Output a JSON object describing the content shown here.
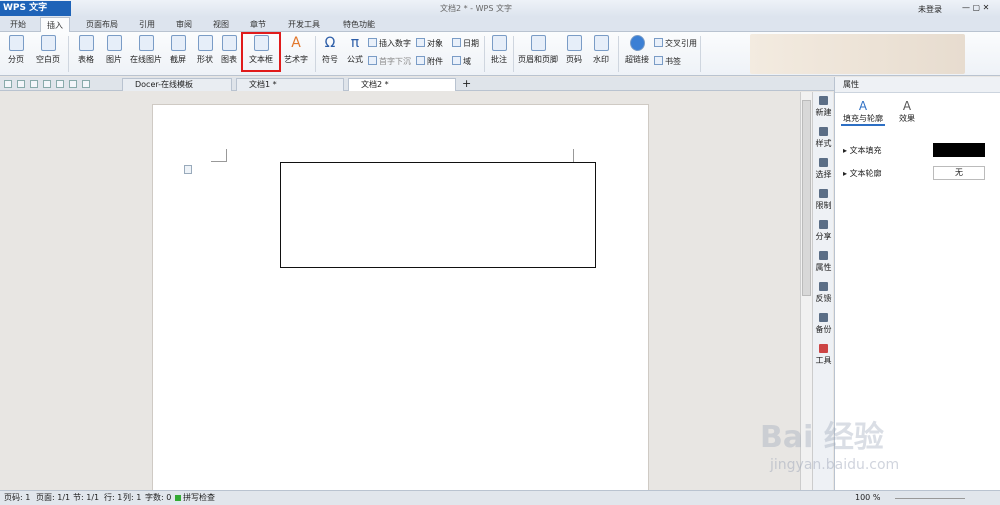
{
  "app": {
    "menu": "WPS 文字",
    "title": "文档2 * - WPS 文字",
    "user": "未登录"
  },
  "tabs": [
    "开始",
    "插入",
    "页面布局",
    "引用",
    "审阅",
    "视图",
    "章节",
    "开发工具",
    "特色功能"
  ],
  "ribbon": {
    "page_break": "分页",
    "blank_page": "空白页",
    "table": "表格",
    "picture": "图片",
    "online_picture": "在线图片",
    "screenshot": "截屏",
    "shape": "形状",
    "chart": "图表",
    "text_box": "文本框",
    "art_text": "艺术字",
    "symbol": "符号",
    "formula": "公式",
    "insert_number": "插入数字",
    "object": "对象",
    "date": "日期",
    "first_drop": "首字下沉",
    "attachment": "附件",
    "field": "域",
    "comment": "批注",
    "header_footer": "页眉和页脚",
    "page_number": "页码",
    "watermark": "水印",
    "hyperlink": "超链接",
    "cross_ref": "交叉引用",
    "bookmark": "书签"
  },
  "doc_tabs": [
    "Docer-在线模板",
    "文档1 *",
    "文档2 *"
  ],
  "sidebar": [
    "新建",
    "样式",
    "选择",
    "限制",
    "分享",
    "属性",
    "反馈",
    "备份",
    "工具"
  ],
  "props": {
    "header": "属性",
    "tab_fill": "填充与轮廓",
    "tab_effect": "效果",
    "text_fill": "文本填充",
    "text_outline": "文本轮廓",
    "outline_value": "无",
    "fill_color": "#000000"
  },
  "status": {
    "page": "页码: 1",
    "pages": "页面: 1/1",
    "section": "节: 1/1",
    "row": "行: 1",
    "col": "列: 1",
    "words": "字数: 0",
    "spell": "拼写检查",
    "zoom": "100 %"
  },
  "watermark": {
    "brand": "Bai 经验",
    "url": "jingyan.baidu.com"
  }
}
